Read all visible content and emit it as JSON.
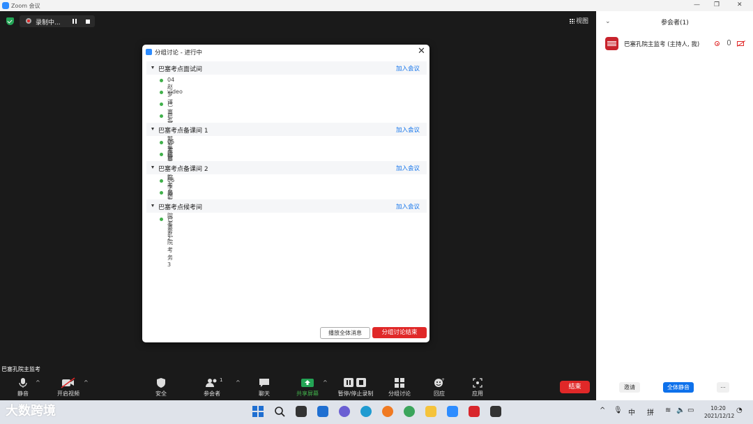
{
  "window": {
    "title": "Zoom 会议",
    "controls": [
      "—",
      "❐",
      "✕"
    ]
  },
  "meeting": {
    "recording_label": "录制中...",
    "view_label": "视图",
    "speaker_name": "巴塞孔院主监考"
  },
  "breakout": {
    "title": "分组讨论 - 进行中",
    "close": "✕",
    "join_label": "加入会议",
    "rooms": [
      {
        "name": "巴塞考点面试间",
        "members": [
          "04 赵梦洋",
          "video",
          "巴塞孔院 外语考官",
          "巴塞罗那孔院 王考官"
        ]
      },
      {
        "name": "巴塞考点备课间 1",
        "members": [
          "05 张简",
          "巴塞孔院考务1"
        ]
      },
      {
        "name": "巴塞考点备课间 2",
        "members": [
          "06 李婉琦",
          "巴塞孔院考务2"
        ]
      },
      {
        "name": "巴塞考点候考间",
        "members": [
          "巴塞孔院考务3"
        ]
      }
    ],
    "broadcast_label": "播放全体消息",
    "end_label": "分组讨论结束"
  },
  "toolbar": {
    "mute": "静音",
    "video": "开启视频",
    "security": "安全",
    "participants": "参会者",
    "participants_count": "1",
    "chat": "聊天",
    "share": "共享屏幕",
    "record": "暂停/停止录制",
    "breakout": "分组讨论",
    "reactions": "回应",
    "apps": "应用",
    "end": "结束"
  },
  "panel": {
    "title": "参会者(1)",
    "participant": "巴塞孔院主监考 (主持人, 我)",
    "invite": "邀请",
    "mute_all": "全体静音",
    "more": "..."
  },
  "taskbar": {
    "watermark": "大数跨境",
    "ime_lang": "中",
    "ime_mode": "拼",
    "time": "10:20",
    "date": "2021/12/12"
  },
  "colors": {
    "accent": "#0e71eb",
    "danger": "#e02828",
    "online": "#41b04b"
  }
}
